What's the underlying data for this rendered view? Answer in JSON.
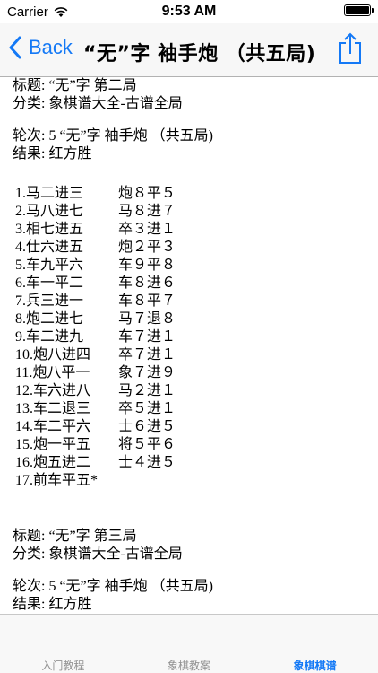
{
  "status_bar": {
    "carrier": "Carrier",
    "time": "9:53 AM"
  },
  "nav": {
    "back_label": "Back",
    "title": "“无”字 袖手炮 （共五局)"
  },
  "records": [
    {
      "title_line": "标题: “无”字 第二局",
      "category_line": "分类: 象棋谱大全-古谱全局",
      "round_line": "轮次: 5 “无”字 袖手炮 （共五局)",
      "result_line": "结果: 红方胜",
      "moves": [
        {
          "red": "1.马二进三",
          "black": "炮８平５"
        },
        {
          "red": "2.马八进七",
          "black": "马８进７"
        },
        {
          "red": "3.相七进五",
          "black": "卒３进１"
        },
        {
          "red": "4.仕六进五",
          "black": "炮２平３"
        },
        {
          "red": "5.车九平六",
          "black": "车９平８"
        },
        {
          "red": "6.车一平二",
          "black": "车８进６"
        },
        {
          "red": "7.兵三进一",
          "black": "车８平７"
        },
        {
          "red": "8.炮二进七",
          "black": "马７退８"
        },
        {
          "red": "9.车二进九",
          "black": "车７进１"
        },
        {
          "red": "10.炮八进四",
          "black": "卒７进１"
        },
        {
          "red": "11.炮八平一",
          "black": "象７进９"
        },
        {
          "red": "12.车六进八",
          "black": "马２进１"
        },
        {
          "red": "13.车二退三",
          "black": "卒５进１"
        },
        {
          "red": "14.车二平六",
          "black": "士６进５"
        },
        {
          "red": "15.炮一平五",
          "black": "将５平６"
        },
        {
          "red": "16.炮五进二",
          "black": "士４进５"
        },
        {
          "red": "17.前车平五*",
          "black": ""
        }
      ]
    },
    {
      "title_line": "标题: “无”字 第三局",
      "category_line": "分类: 象棋谱大全-古谱全局",
      "round_line": "轮次: 5 “无”字 袖手炮 （共五局)",
      "result_line": "结果: 红方胜"
    }
  ],
  "tabs": [
    {
      "label": "入门教程"
    },
    {
      "label": "象棋教案"
    },
    {
      "label": "象棋棋谱"
    }
  ],
  "colors": {
    "accent": "#1479f6",
    "tab_inactive": "#929292"
  }
}
